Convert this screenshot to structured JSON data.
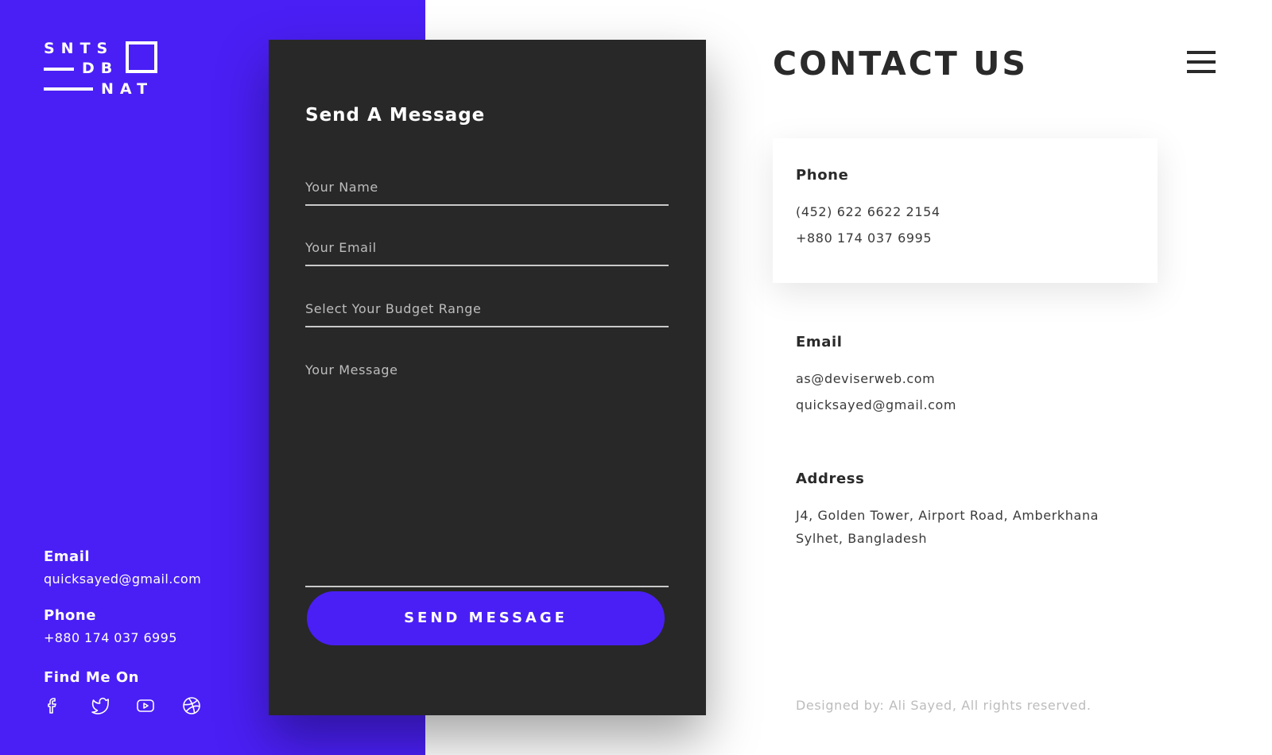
{
  "logo": {
    "line1": "SNTS",
    "line2": "DB",
    "line3": "NAT"
  },
  "sidebar": {
    "email_label": "Email",
    "email_value": "quicksayed@gmail.com",
    "phone_label": "Phone",
    "phone_value": "+880 174 037 6995",
    "find_label": "Find Me On",
    "socials": [
      "facebook-icon",
      "twitter-icon",
      "youtube-icon",
      "dribbble-icon"
    ]
  },
  "form": {
    "title": "Send A Message",
    "name_placeholder": "Your Name",
    "email_placeholder": "Your Email",
    "budget_placeholder": "Select Your Budget Range",
    "message_placeholder": "Your Message",
    "submit_label": "SEND MESSAGE"
  },
  "contact": {
    "title": "CONTACT US",
    "phone_label": "Phone",
    "phones": [
      "(452) 622 6622 2154",
      "+880 174 037 6995"
    ],
    "email_label": "Email",
    "emails": [
      "as@deviserweb.com",
      "quicksayed@gmail.com"
    ],
    "address_label": "Address",
    "address_lines": [
      "J4, Golden Tower, Airport Road, Amberkhana",
      "Sylhet, Bangladesh"
    ]
  },
  "footer": {
    "text": "Designed by: Ali Sayed, All rights reserved."
  },
  "colors": {
    "accent": "#4a1ff5",
    "card_dark": "#282828",
    "text_dark": "#2a2a2a"
  }
}
